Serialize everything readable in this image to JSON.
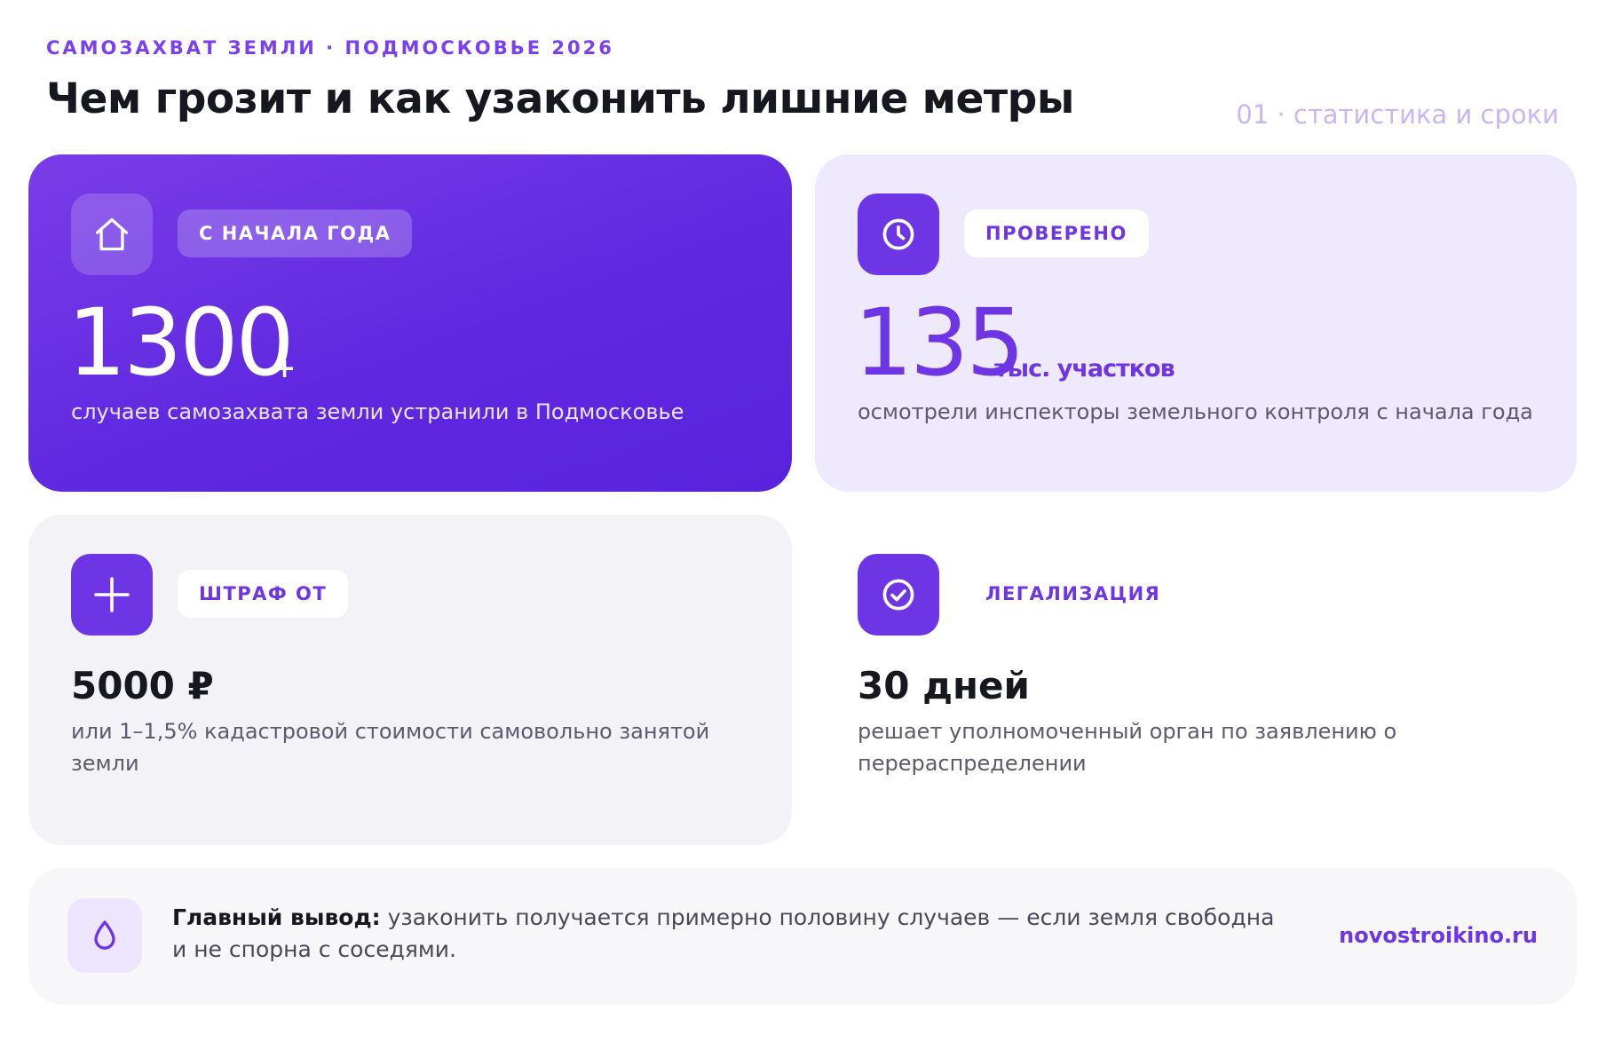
{
  "header": {
    "kicker": "САМОЗАХВАТ ЗЕМЛИ · ПОДМОСКОВЬЕ 2026",
    "title": "Чем грозит и как узаконить лишние метры",
    "section_label": "01 · статистика и сроки"
  },
  "cards": [
    {
      "icon": "home-icon",
      "pill": "С НАЧАЛА ГОДА",
      "value": "1300",
      "suffix": "+",
      "description": "случаев самозахвата земли устранили в Подмосковье"
    },
    {
      "icon": "clock-icon",
      "pill": "ПРОВЕРЕНО",
      "value": "135",
      "suffix": "тыс. участков",
      "description": "осмотрели инспекторы земельного контроля с начала года"
    },
    {
      "icon": "plus-icon",
      "pill": "ШТРАФ ОТ",
      "value": "5000 ₽",
      "description": "или 1–1,5% кадастровой стоимости самовольно занятой земли"
    },
    {
      "icon": "check-circle-icon",
      "pill": "ЛЕГАЛИЗАЦИЯ",
      "value": "30 дней",
      "description": "решает уполномоченный орган по заявлению о перераспределении"
    }
  ],
  "conclusion": {
    "icon": "drop-icon",
    "lead": "Главный вывод:",
    "text": "узаконить получается примерно половину случаев — если земля свободна и не спорна с соседями.",
    "site": "novostroikino.ru"
  },
  "colors": {
    "accent": "#6d35e4",
    "kicker": "#7a3ff0",
    "section_label": "#c9b6f2"
  }
}
